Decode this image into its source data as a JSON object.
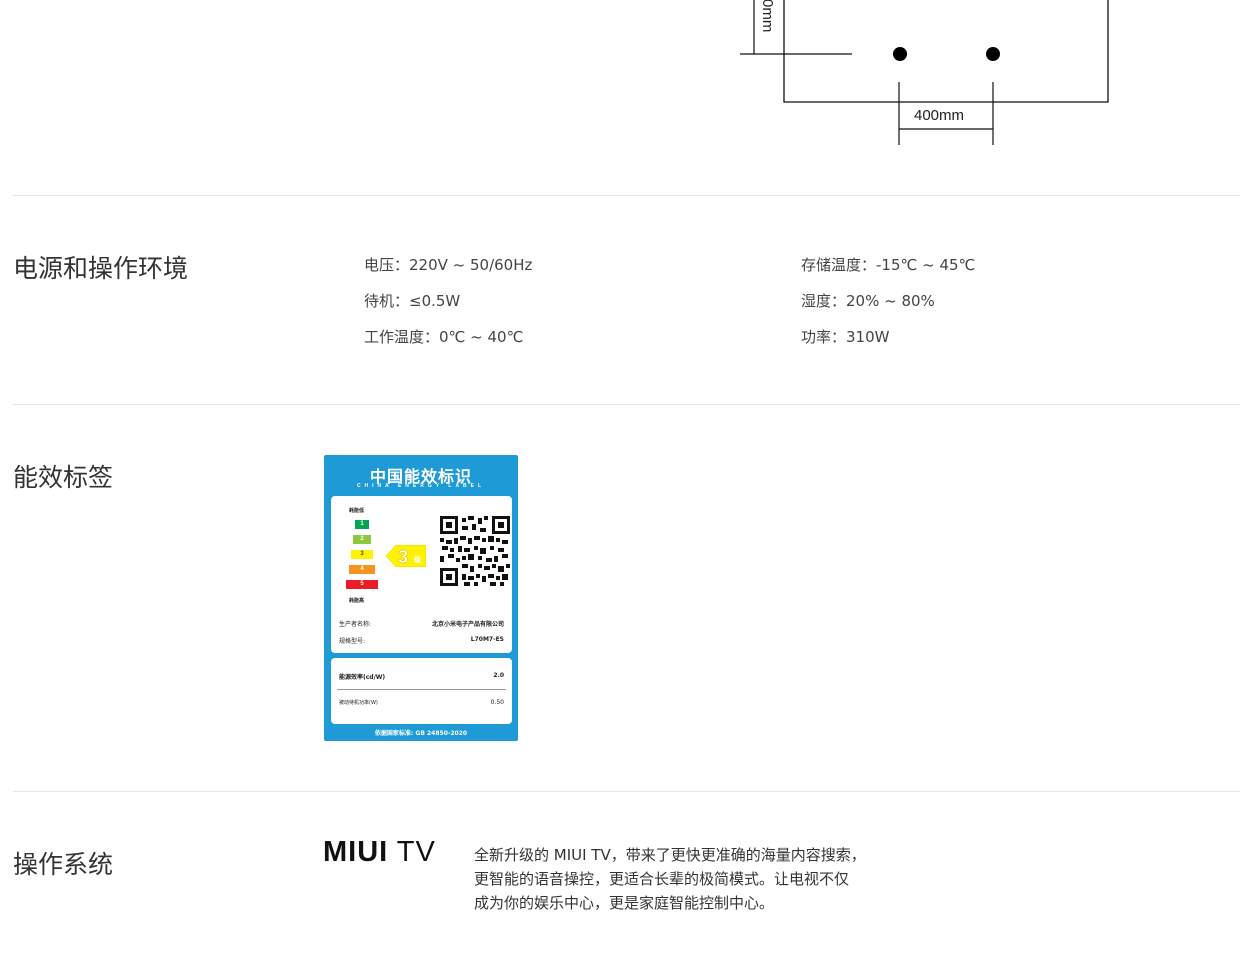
{
  "diagram": {
    "horizontal_dim_label": "400mm",
    "vertical_dim_label_fragment": "0mm"
  },
  "power_section": {
    "title": "电源和操作环境",
    "specs_left": [
      "电压：220V ~ 50/60Hz",
      "待机：≤0.5W",
      "工作温度：0℃ ~ 40℃"
    ],
    "specs_right": [
      "存储温度：-15℃ ~ 45℃",
      "湿度：20% ~ 80%",
      "功率：310W"
    ]
  },
  "energy_section": {
    "title": "能效标签",
    "label": {
      "title": "中国能效标识",
      "subtitle": "CHINA ENERGY LABEL",
      "low_consumption": "耗能低",
      "high_consumption": "耗能高",
      "grades": [
        "1",
        "2",
        "3",
        "4",
        "5"
      ],
      "grade_colors": [
        "#00a651",
        "#8dc63f",
        "#fff200",
        "#f7941d",
        "#ed1c24"
      ],
      "current_grade": "3",
      "current_grade_suffix": "级",
      "manufacturer_label": "生产者名称:",
      "manufacturer_value": "北京小米电子产品有限公司",
      "model_label": "规格型号:",
      "model_value": "L70M7-ES",
      "efficiency_label": "能源效率(cd/W)",
      "efficiency_value": "2.0",
      "standby_label": "被动待机功率(W)",
      "standby_value": "0.50",
      "standard": "依据国家标准: GB 24850-2020",
      "brand_color": "#1e9ad6"
    }
  },
  "os_section": {
    "title": "操作系统",
    "logo_bold": "MIUI",
    "logo_light": "TV",
    "description_lines": [
      "全新升级的 MIUI TV，带来了更快更准确的海量内容搜索，",
      "更智能的语音操控，更适合长辈的极简模式。让电视不仅",
      "成为你的娱乐中心，更是家庭智能控制中心。"
    ]
  }
}
